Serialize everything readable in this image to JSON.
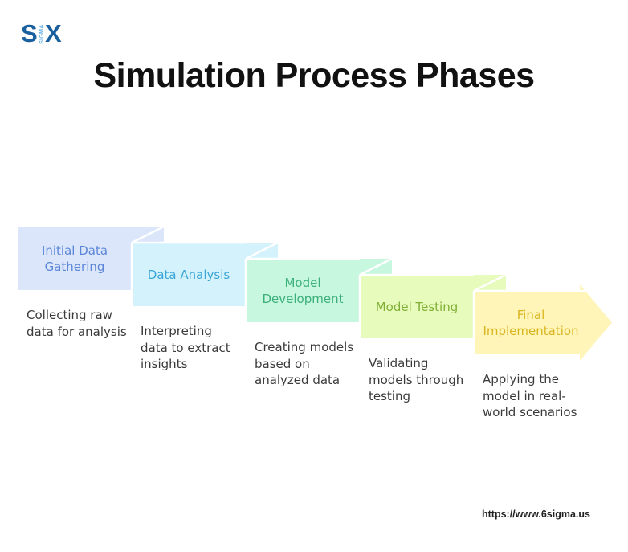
{
  "logo": {
    "left": "S",
    "middle": "SIGMA",
    "right": "X",
    "color": "#1a5f9e",
    "accent": "#6fb6e6"
  },
  "title": "Simulation Process Phases",
  "phases": [
    {
      "label": "Initial Data Gathering",
      "description": "Collecting raw data for analysis",
      "fill": "#dbe6fb",
      "text_color": "#5b86d8"
    },
    {
      "label": "Data Analysis",
      "description": "Interpreting data to extract insights",
      "fill": "#d3f2fc",
      "text_color": "#3aa5d6"
    },
    {
      "label": "Model Development",
      "description": "Creating models based on analyzed data",
      "fill": "#c8f7df",
      "text_color": "#3bb07a"
    },
    {
      "label": "Model Testing",
      "description": "Validating models through testing",
      "fill": "#e7fbbd",
      "text_color": "#7fb034"
    },
    {
      "label": "Final Implementation",
      "description": "Applying the model in real-world scenarios",
      "fill": "#fff5b8",
      "text_color": "#d9b520"
    }
  ],
  "footer": {
    "url": "https://www.6sigma.us"
  }
}
